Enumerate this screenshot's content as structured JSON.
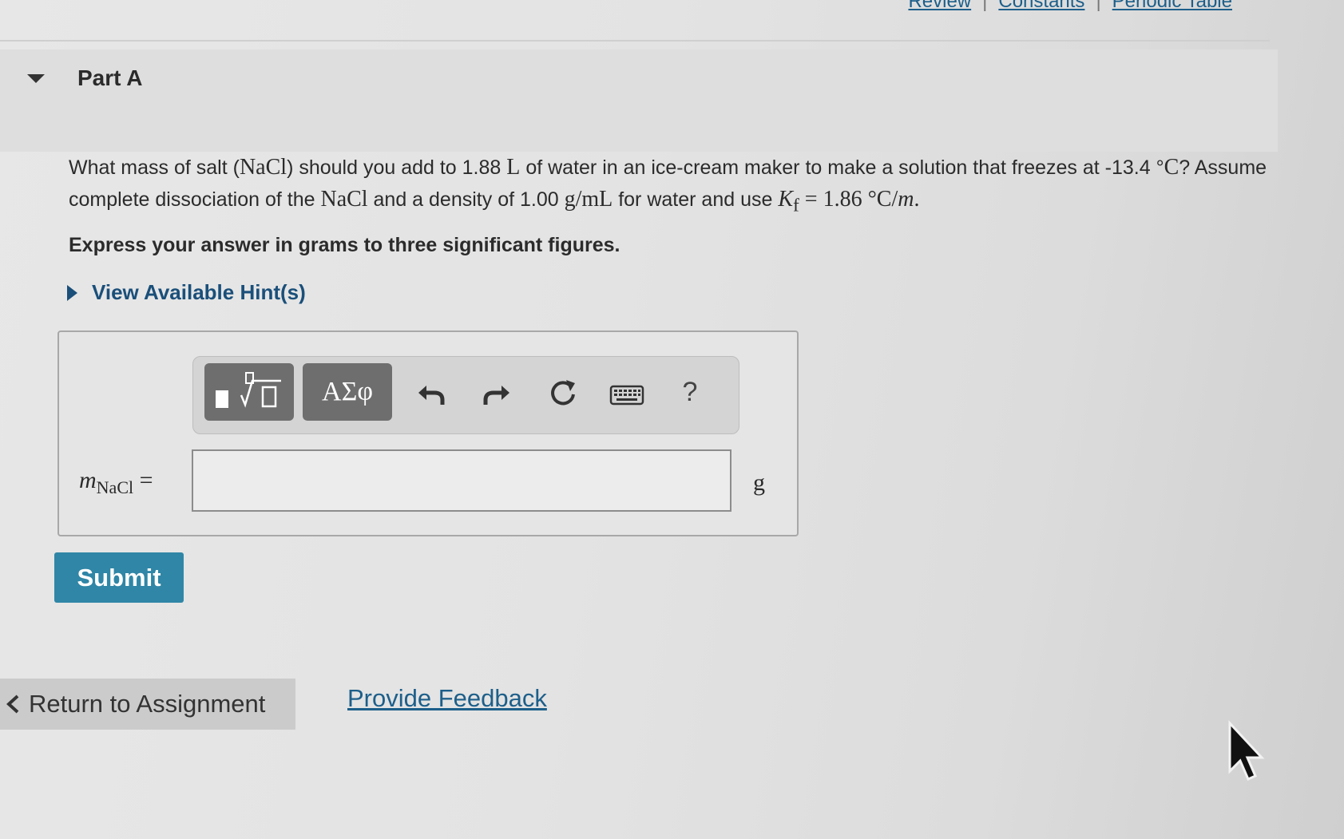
{
  "top_links": [
    "Review",
    "Constants",
    "Periodic Table"
  ],
  "part": {
    "title": "Part A"
  },
  "question": {
    "t1": "What mass of salt (",
    "nacl": "NaCl",
    "t2": ") should you add to 1.88 ",
    "liter": "L",
    "t3": " of water in an ice-cream maker to make a solution that freezes at -13.4 °",
    "deg_unit": "C",
    "t4": "? Assume complete dissociation of the ",
    "t5": " and a density of 1.00 ",
    "density_unit": "g/mL",
    "t6": " for water and use ",
    "kf_symbol": "K",
    "kf_sub": "f",
    "kf_value": " = 1.86 °C/",
    "molal": "m",
    "t7": "."
  },
  "instruction": "Express your answer in grams to three significant figures.",
  "hint_label": "View Available Hint(s)",
  "toolbar": {
    "greek_label": "ΑΣφ",
    "help_label": "?"
  },
  "answer": {
    "variable": "m",
    "variable_sub": "NaCl",
    "equals": "=",
    "value": "",
    "unit": "g"
  },
  "submit_label": "Submit",
  "return_label": "Return to Assignment",
  "feedback_label": "Provide Feedback"
}
